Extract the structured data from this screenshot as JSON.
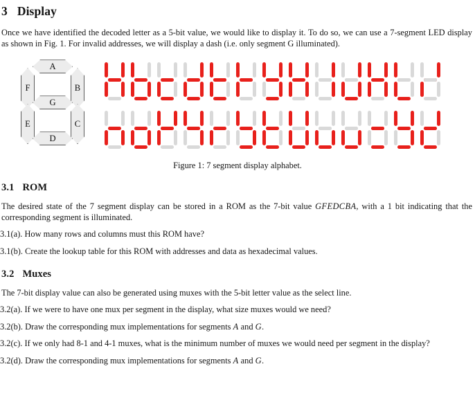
{
  "section": {
    "number": "3",
    "title": "Display",
    "intro": "Once we have identified the decoded letter as a 5-bit value, we would like to display it. To do so, we can use a 7-segment LED display as shown in Fig. 1. For invalid addresses, we will display a dash (i.e. only segment G illuminated)."
  },
  "figure": {
    "caption": "Figure 1: 7 segment display alphabet.",
    "legend": {
      "labels": {
        "A": "A",
        "B": "B",
        "C": "C",
        "D": "D",
        "E": "E",
        "F": "F",
        "G": "G"
      }
    },
    "colors": {
      "segment_on": "#e8201b",
      "segment_off": "#d9d9d9",
      "legend_fill": "#ececec",
      "legend_stroke": "#5a5a5a"
    },
    "segment_order": [
      "A",
      "B",
      "C",
      "D",
      "E",
      "F",
      "G"
    ],
    "rows": [
      {
        "chars": [
          {
            "letter": "A",
            "segments": [
              1,
              1,
              1,
              0,
              1,
              1,
              1
            ]
          },
          {
            "letter": "b",
            "segments": [
              0,
              0,
              1,
              1,
              1,
              1,
              1
            ]
          },
          {
            "letter": "c",
            "segments": [
              0,
              0,
              0,
              1,
              1,
              0,
              1
            ]
          },
          {
            "letter": "d",
            "segments": [
              0,
              1,
              1,
              1,
              1,
              0,
              1
            ]
          },
          {
            "letter": "E",
            "segments": [
              1,
              0,
              0,
              1,
              1,
              1,
              1
            ]
          },
          {
            "letter": "F",
            "segments": [
              1,
              0,
              0,
              0,
              1,
              1,
              1
            ]
          },
          {
            "letter": "g",
            "segments": [
              1,
              1,
              1,
              1,
              0,
              1,
              1
            ]
          },
          {
            "letter": "H",
            "segments": [
              0,
              1,
              1,
              0,
              1,
              1,
              1
            ]
          },
          {
            "letter": "I",
            "segments": [
              0,
              1,
              1,
              0,
              0,
              0,
              0
            ]
          },
          {
            "letter": "J",
            "segments": [
              0,
              1,
              1,
              1,
              1,
              0,
              0
            ]
          },
          {
            "letter": "k",
            "segments": [
              0,
              1,
              1,
              0,
              1,
              1,
              1
            ]
          },
          {
            "letter": "L",
            "segments": [
              0,
              0,
              0,
              1,
              1,
              1,
              0
            ]
          },
          {
            "letter": "M",
            "segments": [
              1,
              1,
              0,
              0,
              1,
              0,
              0
            ]
          }
        ]
      },
      {
        "chars": [
          {
            "letter": "n",
            "segments": [
              0,
              0,
              1,
              0,
              1,
              0,
              1
            ]
          },
          {
            "letter": "o",
            "segments": [
              0,
              0,
              1,
              1,
              1,
              0,
              1
            ]
          },
          {
            "letter": "P",
            "segments": [
              1,
              1,
              0,
              0,
              1,
              1,
              1
            ]
          },
          {
            "letter": "q",
            "segments": [
              1,
              1,
              1,
              0,
              0,
              1,
              1
            ]
          },
          {
            "letter": "r",
            "segments": [
              0,
              0,
              0,
              0,
              1,
              0,
              1
            ]
          },
          {
            "letter": "S",
            "segments": [
              1,
              0,
              1,
              1,
              0,
              1,
              1
            ]
          },
          {
            "letter": "t",
            "segments": [
              0,
              0,
              0,
              1,
              1,
              1,
              1
            ]
          },
          {
            "letter": "U",
            "segments": [
              0,
              1,
              1,
              1,
              1,
              1,
              0
            ]
          },
          {
            "letter": "V",
            "segments": [
              0,
              0,
              1,
              1,
              1,
              0,
              0
            ]
          },
          {
            "letter": "W",
            "segments": [
              0,
              0,
              1,
              1,
              1,
              0,
              0
            ]
          },
          {
            "letter": "X",
            "segments": [
              1,
              0,
              0,
              1,
              0,
              0,
              1
            ]
          },
          {
            "letter": "y",
            "segments": [
              0,
              1,
              1,
              1,
              0,
              1,
              1
            ]
          },
          {
            "letter": "z",
            "segments": [
              1,
              1,
              0,
              1,
              1,
              0,
              1
            ]
          }
        ]
      }
    ]
  },
  "subsections": [
    {
      "number": "3.1",
      "title": "ROM",
      "intro_pre": "The desired state of the 7 segment display can be stored in a ROM as the 7-bit value ",
      "intro_math": "GFEDCBA",
      "intro_post": ", with a 1 bit indicating that the corresponding segment is illuminated.",
      "items": [
        {
          "label": "3.1(a).",
          "text": "How many rows and columns must this ROM have?"
        },
        {
          "label": "3.1(b).",
          "text": "Create the lookup table for this ROM with addresses and data as hexadecimal values."
        }
      ]
    },
    {
      "number": "3.2",
      "title": "Muxes",
      "intro": "The 7-bit display value can also be generated using muxes with the 5-bit letter value as the select line.",
      "items": [
        {
          "label": "3.2(a).",
          "text": "If we were to have one mux per segment in the display, what size muxes would we need?"
        },
        {
          "label": "3.2(b).",
          "pre": "Draw the corresponding mux implementations for segments ",
          "math1": "A",
          "mid": " and ",
          "math2": "G",
          "post": "."
        },
        {
          "label": "3.2(c).",
          "text": "If we only had 8-1 and 4-1 muxes, what is the minimum number of muxes we would need per segment in the display?"
        },
        {
          "label": "3.2(d).",
          "pre": "Draw the corresponding mux implementations for segments ",
          "math1": "A",
          "mid": " and ",
          "math2": "G",
          "post": "."
        }
      ]
    }
  ]
}
